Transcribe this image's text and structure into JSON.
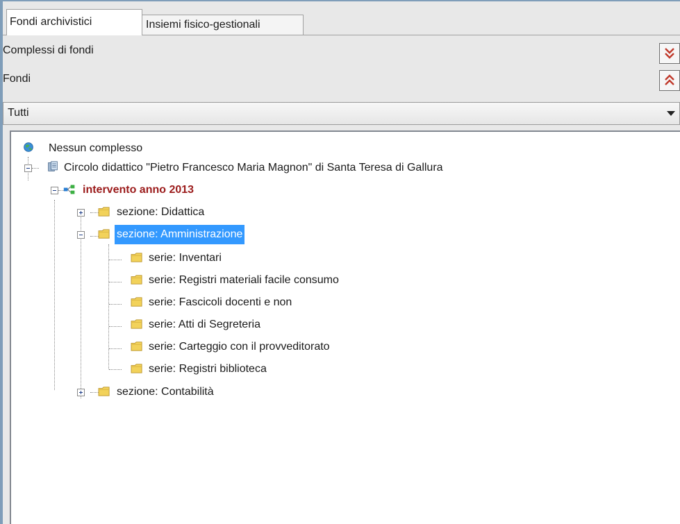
{
  "tabs": [
    {
      "label": "Fondi archivistici",
      "active": true
    },
    {
      "label": "Insiemi fisico-gestionali",
      "active": false
    }
  ],
  "rows": {
    "complessi_label": "Complessi di fondi",
    "fondi_label": "Fondi"
  },
  "filter": {
    "selected": "Tutti"
  },
  "tree": {
    "root": {
      "label": "Nessun complesso",
      "icon": "globe-icon"
    },
    "complex": {
      "label": "Circolo didattico \"Pietro Francesco Maria Magnon\" di Santa Teresa di Gallura",
      "icon": "database-icon"
    },
    "intervento": {
      "label": "intervento anno 2013",
      "icon": "network-icon"
    },
    "sections": [
      {
        "label": "sezione: Didattica",
        "expanded": false
      },
      {
        "label": "sezione: Amministrazione",
        "expanded": true,
        "selected": true
      },
      {
        "label": "sezione: Contabilità",
        "expanded": false
      }
    ],
    "series": [
      {
        "label": "serie: Inventari"
      },
      {
        "label": "serie: Registri materiali facile consumo"
      },
      {
        "label": "serie: Fascicoli docenti e non"
      },
      {
        "label": "serie: Atti di Segreteria"
      },
      {
        "label": "serie: Carteggio con il provveditorato"
      },
      {
        "label": "serie: Registri biblioteca"
      }
    ]
  },
  "colors": {
    "selection": "#3399ff",
    "intervento_text": "#9b1b1b",
    "folder": "#f2d25a"
  }
}
